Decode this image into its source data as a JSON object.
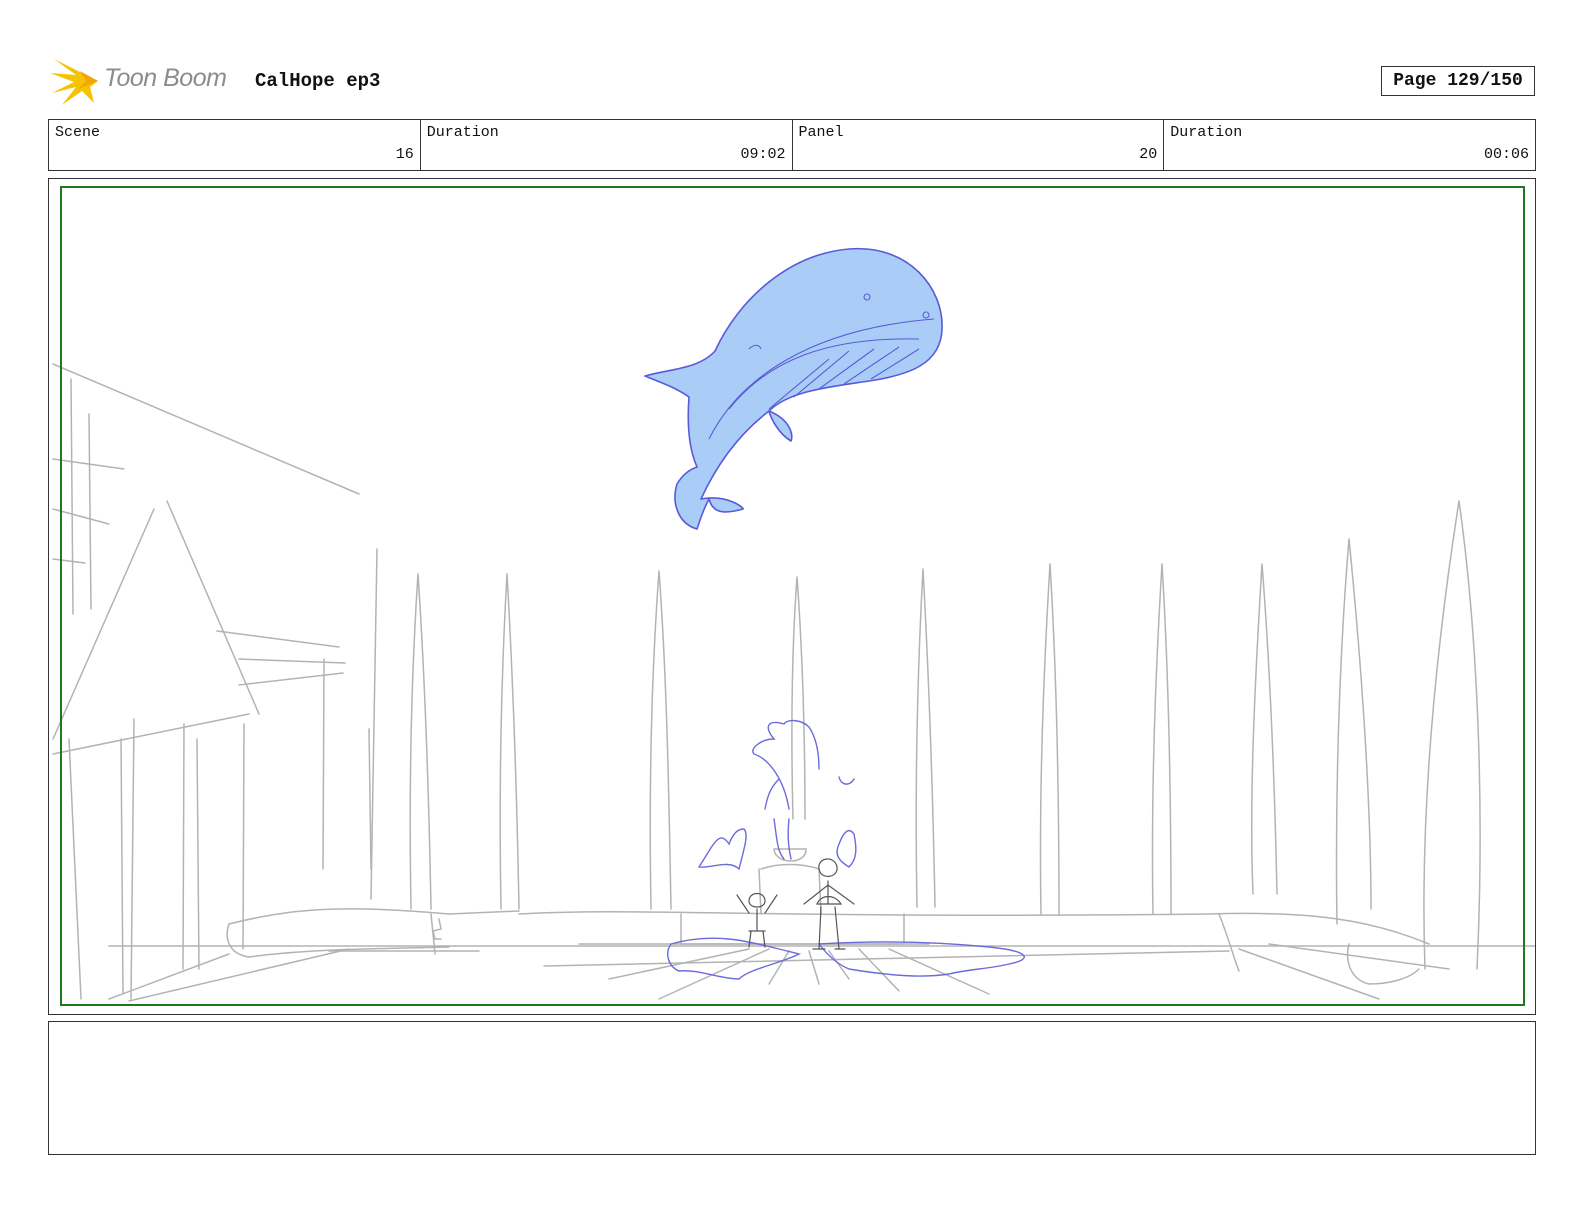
{
  "header": {
    "logo_text": "Toon Boom",
    "project_title": "CalHope ep3",
    "page_label": "Page 129/150"
  },
  "info": {
    "scene_label": "Scene",
    "scene_value": "16",
    "scene_duration_label": "Duration",
    "scene_duration_value": "09:02",
    "panel_label": "Panel",
    "panel_value": "20",
    "panel_duration_label": "Duration",
    "panel_duration_value": "00:06"
  },
  "notes": {
    "text": ""
  },
  "colors": {
    "safe_frame": "#1f7a1f",
    "whale_fill": "#a9cdf7",
    "whale_stroke": "#5a5ad8",
    "sketch_gray": "#b3b3b3",
    "logo_yellow": "#f5c400"
  }
}
